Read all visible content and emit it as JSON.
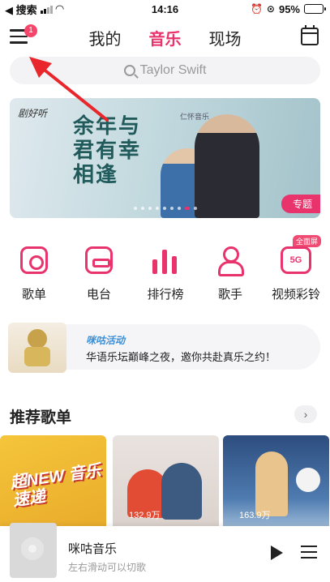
{
  "status_bar": {
    "back_app": "◀ 搜索",
    "time": "14:16",
    "battery": "95%",
    "battery_level": 0.95
  },
  "header": {
    "menu_badge": "1",
    "tabs": [
      {
        "label": "我的",
        "active": false
      },
      {
        "label": "音乐",
        "active": true
      },
      {
        "label": "现场",
        "active": false
      }
    ],
    "calendar_icon": "calendar-icon"
  },
  "search": {
    "placeholder": "Taylor Swift"
  },
  "banner": {
    "brand_left": "剧好听",
    "brand_right": "仁怀音乐",
    "title": "余年与君有幸相逢",
    "tag": "专题"
  },
  "quick_menu": [
    {
      "label": "歌单",
      "icon": "songlist-icon"
    },
    {
      "label": "电台",
      "icon": "radio-icon"
    },
    {
      "label": "排行榜",
      "icon": "chart-icon"
    },
    {
      "label": "歌手",
      "icon": "singer-icon"
    },
    {
      "label": "视频彩铃",
      "icon": "video-ringtone-icon",
      "badge": "全面屏",
      "icon_text": "5G"
    }
  ],
  "activity": {
    "tag": "咪咕活动",
    "text": "华语乐坛巅峰之夜，邀你共赴真乐之约！"
  },
  "recommend": {
    "title": "推荐歌单",
    "more": "›",
    "cards": [
      {
        "text": "超NEW 音乐速递",
        "count": ""
      },
      {
        "text": "",
        "count": "132.9万"
      },
      {
        "text": "",
        "count": "163.9万"
      }
    ]
  },
  "player": {
    "title": "咪咕音乐",
    "subtitle": "左右滑动可以切歌"
  },
  "colors": {
    "accent": "#e8336c",
    "annotation": "#e8262b"
  }
}
